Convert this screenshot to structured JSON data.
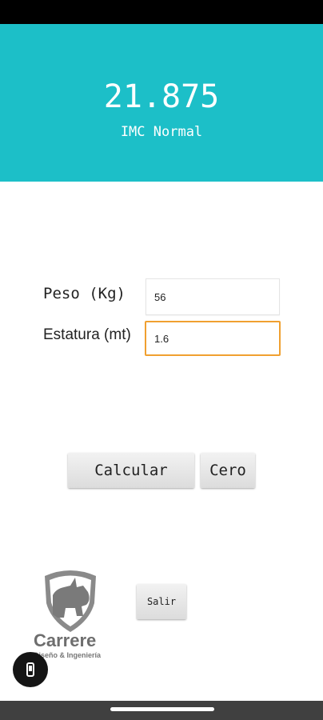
{
  "result": {
    "value": "21.875",
    "category": "IMC Normal"
  },
  "form": {
    "peso_label": "Peso (Kg)",
    "peso_value": "56",
    "estatura_label": "Estatura (mt)",
    "estatura_value": "1.6"
  },
  "buttons": {
    "calcular": "Calcular",
    "cero": "Cero",
    "salir": "Salir"
  },
  "logo": {
    "name": "Carrere",
    "tagline": "Diseño & Ingeniería",
    "icon": "rhino-shield-icon"
  },
  "floating_button": {
    "icon": "screen-rotate-icon"
  },
  "colors": {
    "accent": "#1cbfc8",
    "focus_border": "#f0a030"
  }
}
